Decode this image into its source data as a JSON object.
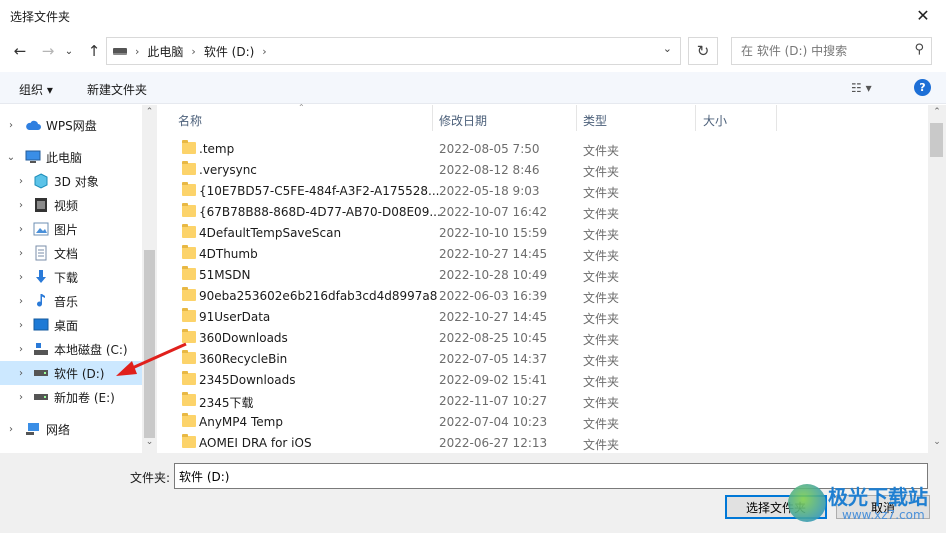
{
  "window": {
    "title": "选择文件夹"
  },
  "address": {
    "crumbs": [
      "此电脑",
      "软件 (D:)"
    ],
    "search_placeholder": "在 软件 (D:) 中搜索"
  },
  "toolbar": {
    "organize": "组织 ▾",
    "new_folder": "新建文件夹",
    "view_glyph": "☷ ▾",
    "help_glyph": "?"
  },
  "sidebar": {
    "items": [
      {
        "label": "WPS网盘",
        "icon": "cloud-icon"
      },
      {
        "label": "此电脑",
        "icon": "computer-icon"
      },
      {
        "label": "3D 对象",
        "icon": "3d-objects-icon"
      },
      {
        "label": "视频",
        "icon": "video-icon"
      },
      {
        "label": "图片",
        "icon": "pictures-icon"
      },
      {
        "label": "文档",
        "icon": "documents-icon"
      },
      {
        "label": "下载",
        "icon": "download-icon"
      },
      {
        "label": "音乐",
        "icon": "music-icon"
      },
      {
        "label": "桌面",
        "icon": "desktop-icon"
      },
      {
        "label": "本地磁盘 (C:)",
        "icon": "system-drive-icon"
      },
      {
        "label": "软件 (D:)",
        "icon": "drive-icon"
      },
      {
        "label": "新加卷 (E:)",
        "icon": "drive-icon"
      },
      {
        "label": "网络",
        "icon": "network-icon"
      }
    ]
  },
  "columns": {
    "name": "名称",
    "date": "修改日期",
    "type": "类型",
    "size": "大小"
  },
  "files": [
    {
      "name": ".temp",
      "date": "2022-08-05 7:50",
      "type": "文件夹"
    },
    {
      "name": ".verysync",
      "date": "2022-08-12 8:46",
      "type": "文件夹"
    },
    {
      "name": "{10E7BD57-C5FE-484f-A3F2-A175528...",
      "date": "2022-05-18 9:03",
      "type": "文件夹"
    },
    {
      "name": "{67B78B88-868D-4D77-AB70-D08E09...",
      "date": "2022-10-07 16:42",
      "type": "文件夹"
    },
    {
      "name": "4DefaultTempSaveScan",
      "date": "2022-10-10 15:59",
      "type": "文件夹"
    },
    {
      "name": "4DThumb",
      "date": "2022-10-27 14:45",
      "type": "文件夹"
    },
    {
      "name": "51MSDN",
      "date": "2022-10-28 10:49",
      "type": "文件夹"
    },
    {
      "name": "90eba253602e6b216dfab3cd4d8997a8",
      "date": "2022-06-03 16:39",
      "type": "文件夹"
    },
    {
      "name": "91UserData",
      "date": "2022-10-27 14:45",
      "type": "文件夹"
    },
    {
      "name": "360Downloads",
      "date": "2022-08-25 10:45",
      "type": "文件夹"
    },
    {
      "name": "360RecycleBin",
      "date": "2022-07-05 14:37",
      "type": "文件夹"
    },
    {
      "name": "2345Downloads",
      "date": "2022-09-02 15:41",
      "type": "文件夹"
    },
    {
      "name": "2345下载",
      "date": "2022-11-07 10:27",
      "type": "文件夹"
    },
    {
      "name": "AnyMP4 Temp",
      "date": "2022-07-04 10:23",
      "type": "文件夹"
    },
    {
      "name": "AOMEI DRA for iOS",
      "date": "2022-06-27 12:13",
      "type": "文件夹"
    }
  ],
  "bottom": {
    "folder_label": "文件夹:",
    "folder_value": "软件 (D:)",
    "select_label": "选择文件夹",
    "cancel_label": "取消"
  },
  "watermark": {
    "brand": "极光下载站",
    "url": "www.xz7.com"
  },
  "colors": {
    "selection": "#cce8ff",
    "folder": "#fcd36a",
    "accent": "#0078d7",
    "arrow": "#e0201c"
  }
}
